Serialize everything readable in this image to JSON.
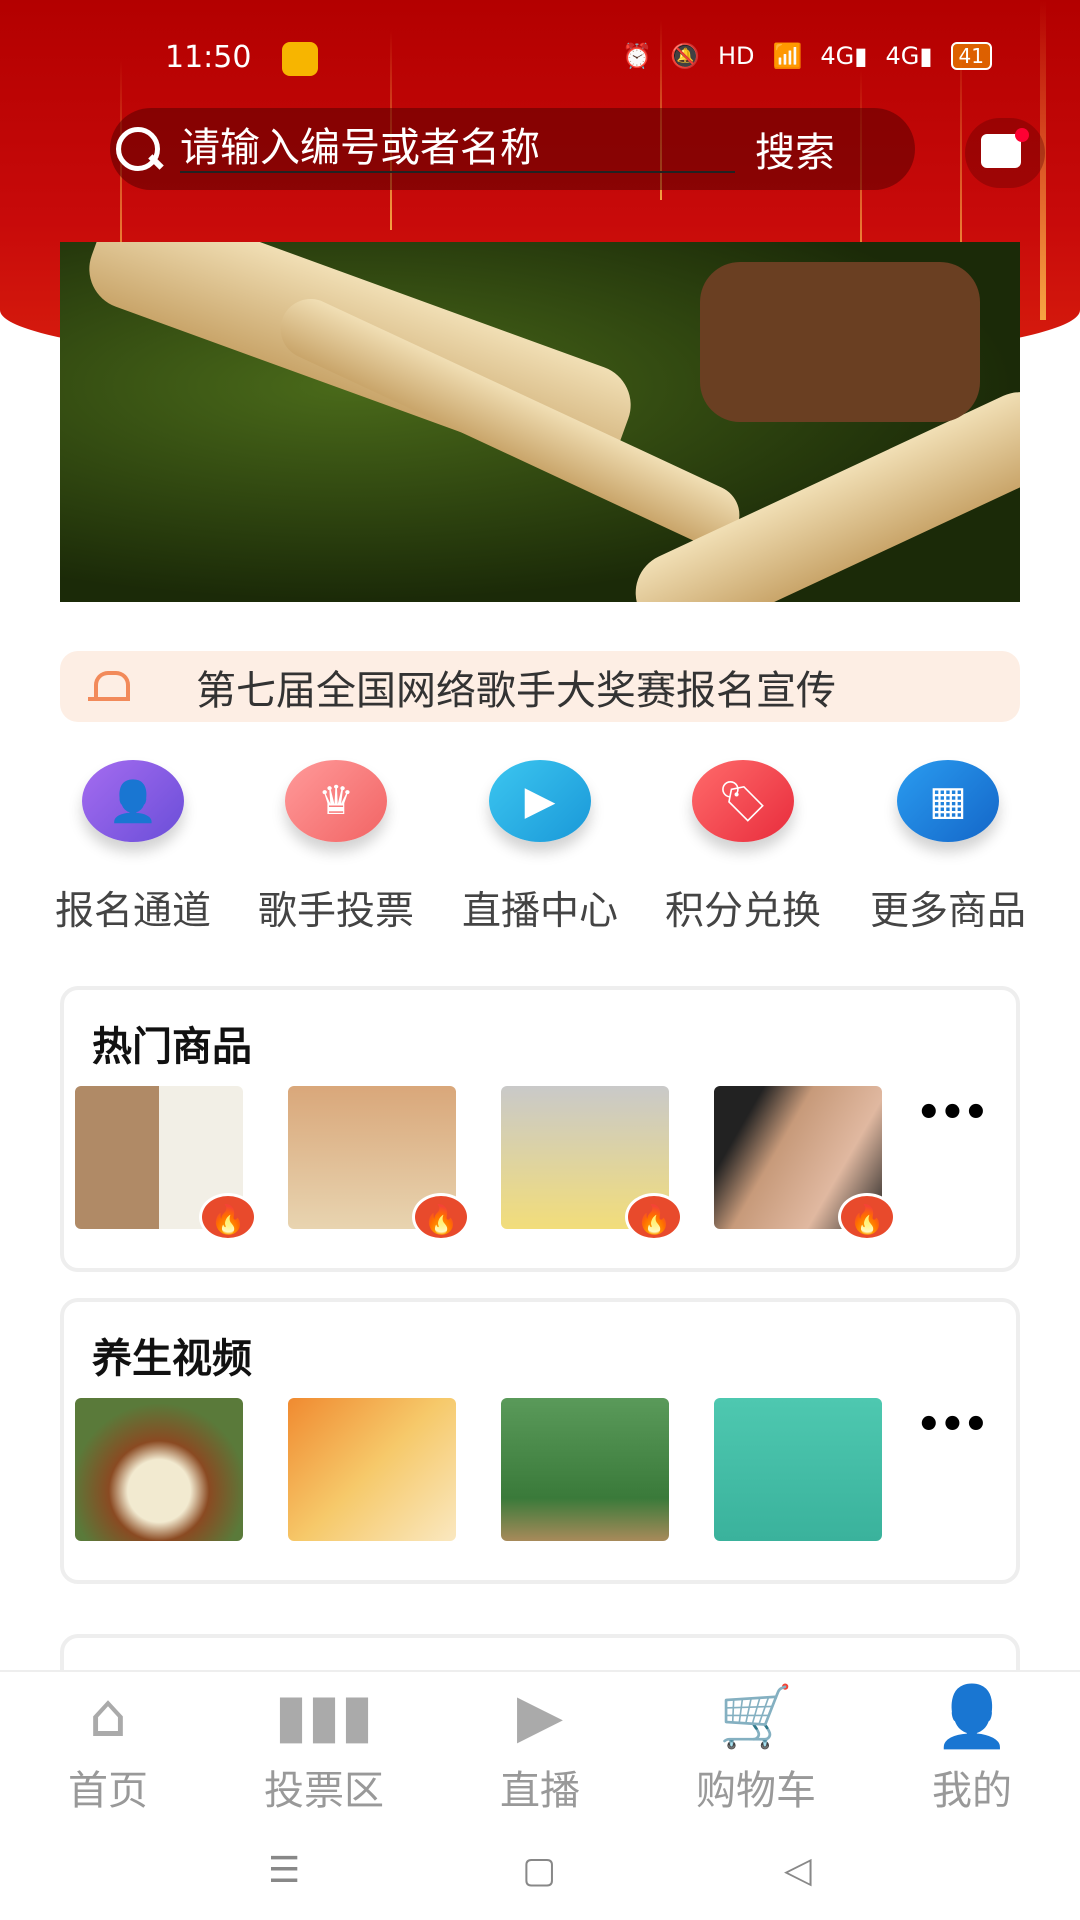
{
  "status_bar": {
    "time": "11:50",
    "battery": "41",
    "icons": [
      "weibo-app-icon",
      "alarm-icon",
      "mute-icon",
      "hd-icon",
      "wifi-icon",
      "signal-4g-icon",
      "signal-4g-icon",
      "battery-icon"
    ]
  },
  "search": {
    "placeholder": "请输入编号或者名称",
    "button": "搜索"
  },
  "notice": {
    "text": "第七届全国网络歌手大奖赛报名宣传"
  },
  "quick_actions": [
    {
      "label": "报名通道",
      "icon": "user-add-icon",
      "color": "#8a5ce0"
    },
    {
      "label": "歌手投票",
      "icon": "crown-icon",
      "color": "#f47a7a"
    },
    {
      "label": "直播中心",
      "icon": "video-camera-icon",
      "color": "#22a8e0"
    },
    {
      "label": "积分兑换",
      "icon": "tag-icon",
      "color": "#f24a4a"
    },
    {
      "label": "更多商品",
      "icon": "grid-icon",
      "color": "#1f7fd8"
    }
  ],
  "sections": [
    {
      "title": "热门商品",
      "more": "•••",
      "badge_icon": "fire-icon"
    },
    {
      "title": "养生视频",
      "more": "•••"
    }
  ],
  "tabbar": [
    {
      "label": "首页",
      "icon": "home-icon"
    },
    {
      "label": "投票区",
      "icon": "vote-bars-icon"
    },
    {
      "label": "直播",
      "icon": "video-icon"
    },
    {
      "label": "购物车",
      "icon": "cart-icon"
    },
    {
      "label": "我的",
      "icon": "user-icon"
    }
  ]
}
